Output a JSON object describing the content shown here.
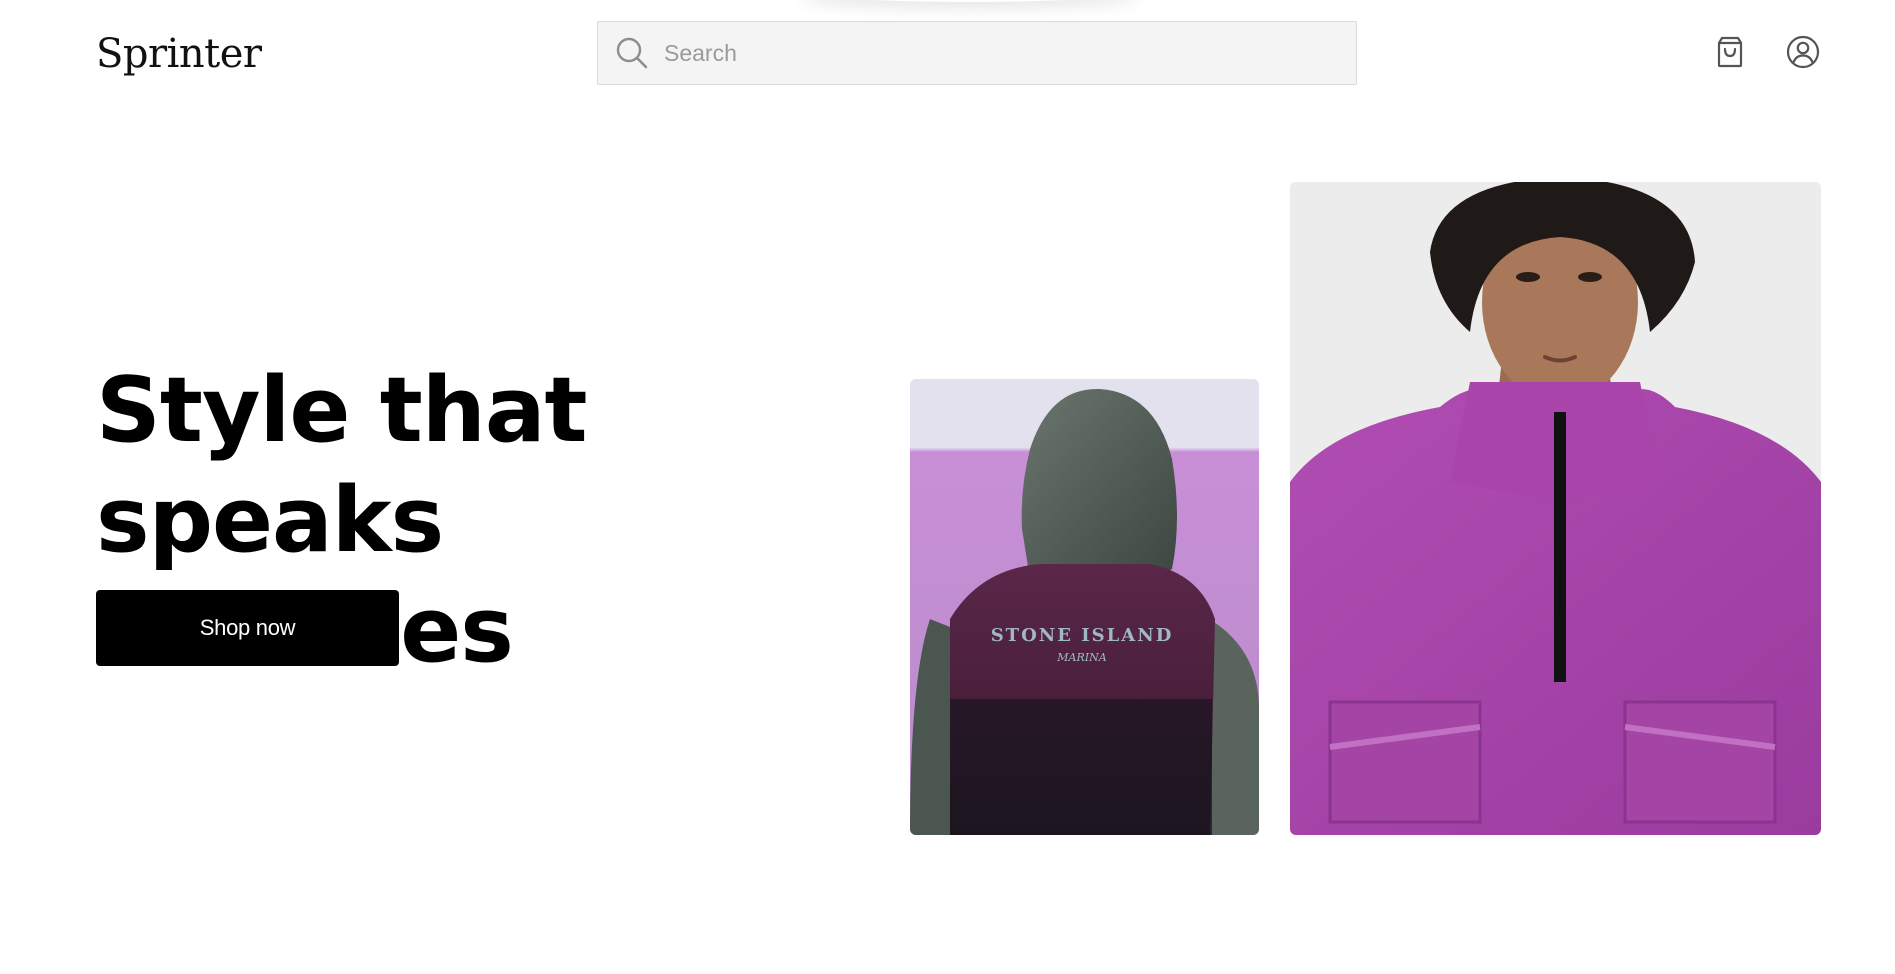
{
  "header": {
    "logo": "Sprinter",
    "search": {
      "placeholder": "Search",
      "value": "",
      "icon": "search-icon"
    },
    "cart_icon": "shopping-bag-icon",
    "account_icon": "user-circle-icon"
  },
  "hero": {
    "title": "Style that speaks volumes",
    "cta_label": "Shop now",
    "images": [
      {
        "name": "hooded-vest-back-photo",
        "garment_text_line1": "STONE ISLAND",
        "garment_text_line2": "MARINA"
      },
      {
        "name": "purple-half-zip-jacket-photo"
      }
    ]
  },
  "colors": {
    "background": "#ffffff",
    "text": "#000000",
    "button_bg": "#000000",
    "button_text": "#ffffff",
    "search_bg": "#f4f4f4",
    "accent_purple": "#a43da4"
  }
}
